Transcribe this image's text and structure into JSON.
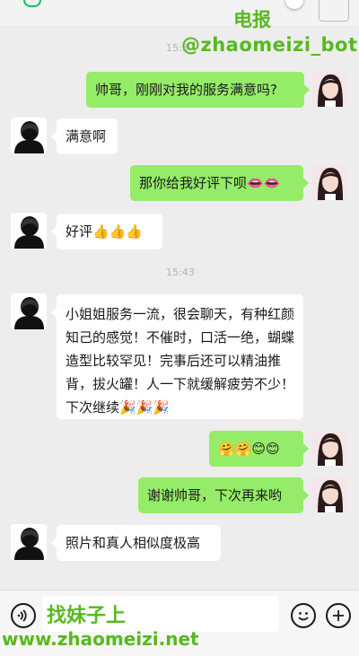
{
  "watermarks": {
    "telegram": "电报",
    "bot_handle": "@zhaomeizi_bot",
    "find_text": "找妹子上",
    "site_url": "www.zhaomeizi.net"
  },
  "timestamps": [
    "15:3",
    "15:43"
  ],
  "messages": [
    {
      "side": "right",
      "text": "帅哥，刚刚对我的服务满意吗?"
    },
    {
      "side": "left",
      "text": "满意啊"
    },
    {
      "side": "right",
      "text": "那你给我好评下呗👄👄"
    },
    {
      "side": "left",
      "text": "好评👍👍👍"
    },
    {
      "side": "left",
      "text": "小姐姐服务一流，很会聊天，有种红颜知己的感觉！不催时，口活一绝，蝴蝶造型比较罕见！完事后还可以精油推背，拔火罐！人一下就缓解疲劳不少！下次继续🎉🎉🎉"
    },
    {
      "side": "right",
      "text": "🤗🤗😊😊"
    },
    {
      "side": "right",
      "text": "谢谢帅哥，下次再来哟"
    },
    {
      "side": "left",
      "text": "照片和真人相似度极高"
    }
  ],
  "colors": {
    "background": "#ededed",
    "bubble_right": "#95ec69",
    "bubble_left": "#ffffff",
    "watermark": "#57b820",
    "timestamp": "#b2b2b2"
  },
  "icons": {
    "voice": "voice-icon",
    "emoji": "emoji-icon",
    "more": "plus-icon"
  }
}
